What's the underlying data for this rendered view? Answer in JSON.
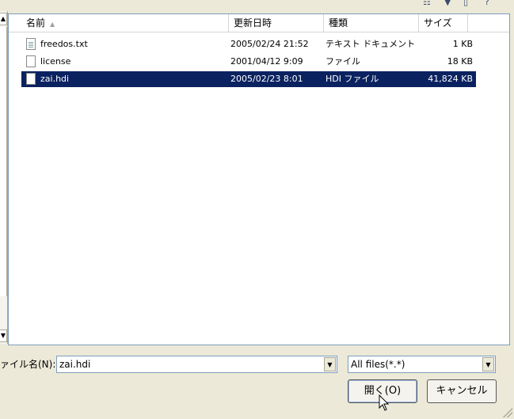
{
  "columns": {
    "name": "名前",
    "modified": "更新日時",
    "type": "種類",
    "size": "サイズ"
  },
  "files": [
    {
      "name": "freedos.txt",
      "modified": "2005/02/24 21:52",
      "type": "テキスト ドキュメント",
      "size": "1 KB",
      "icon": "text-file-icon",
      "selected": false
    },
    {
      "name": "license",
      "modified": "2001/04/12 9:09",
      "type": "ファイル",
      "size": "18 KB",
      "icon": "file-icon",
      "selected": false
    },
    {
      "name": "zai.hdi",
      "modified": "2005/02/23 8:01",
      "type": "HDI ファイル",
      "size": "41,824 KB",
      "icon": "file-icon",
      "selected": true
    }
  ],
  "filename": {
    "label": "ァイル名(N):",
    "value": "zai.hdi"
  },
  "filter": {
    "value": "All files(*.*)"
  },
  "buttons": {
    "open": "開く(O)",
    "cancel": "キャンセル"
  },
  "colors": {
    "selection": "#0b2260",
    "dialog_bg": "#ece9d8"
  }
}
